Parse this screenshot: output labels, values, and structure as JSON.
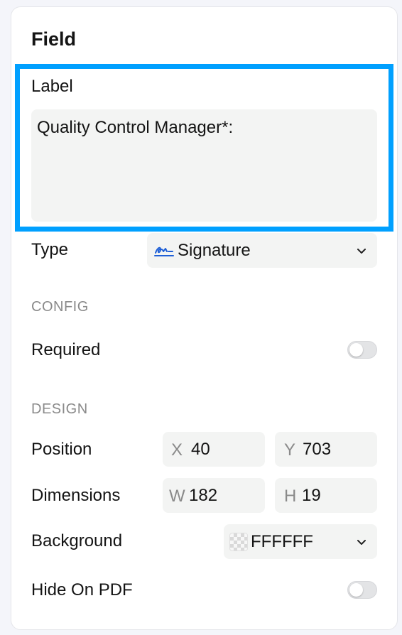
{
  "panel": {
    "title": "Field"
  },
  "label_field": {
    "label": "Label",
    "value": "Quality Control Manager*:"
  },
  "type_field": {
    "label": "Type",
    "value": "Signature",
    "icon": "signature-icon"
  },
  "config": {
    "heading": "CONFIG",
    "required": {
      "label": "Required",
      "on": false
    }
  },
  "design": {
    "heading": "DESIGN",
    "position": {
      "label": "Position",
      "x_prefix": "X",
      "x": "40",
      "y_prefix": "Y",
      "y": "703"
    },
    "dimensions": {
      "label": "Dimensions",
      "w_prefix": "W",
      "w": "182",
      "h_prefix": "H",
      "h": "19"
    },
    "background": {
      "label": "Background",
      "value": "FFFFFF"
    },
    "hide_on_pdf": {
      "label": "Hide On PDF",
      "on": false
    }
  },
  "colors": {
    "highlight": "#00a0ff",
    "accent": "#1f5fd6"
  }
}
